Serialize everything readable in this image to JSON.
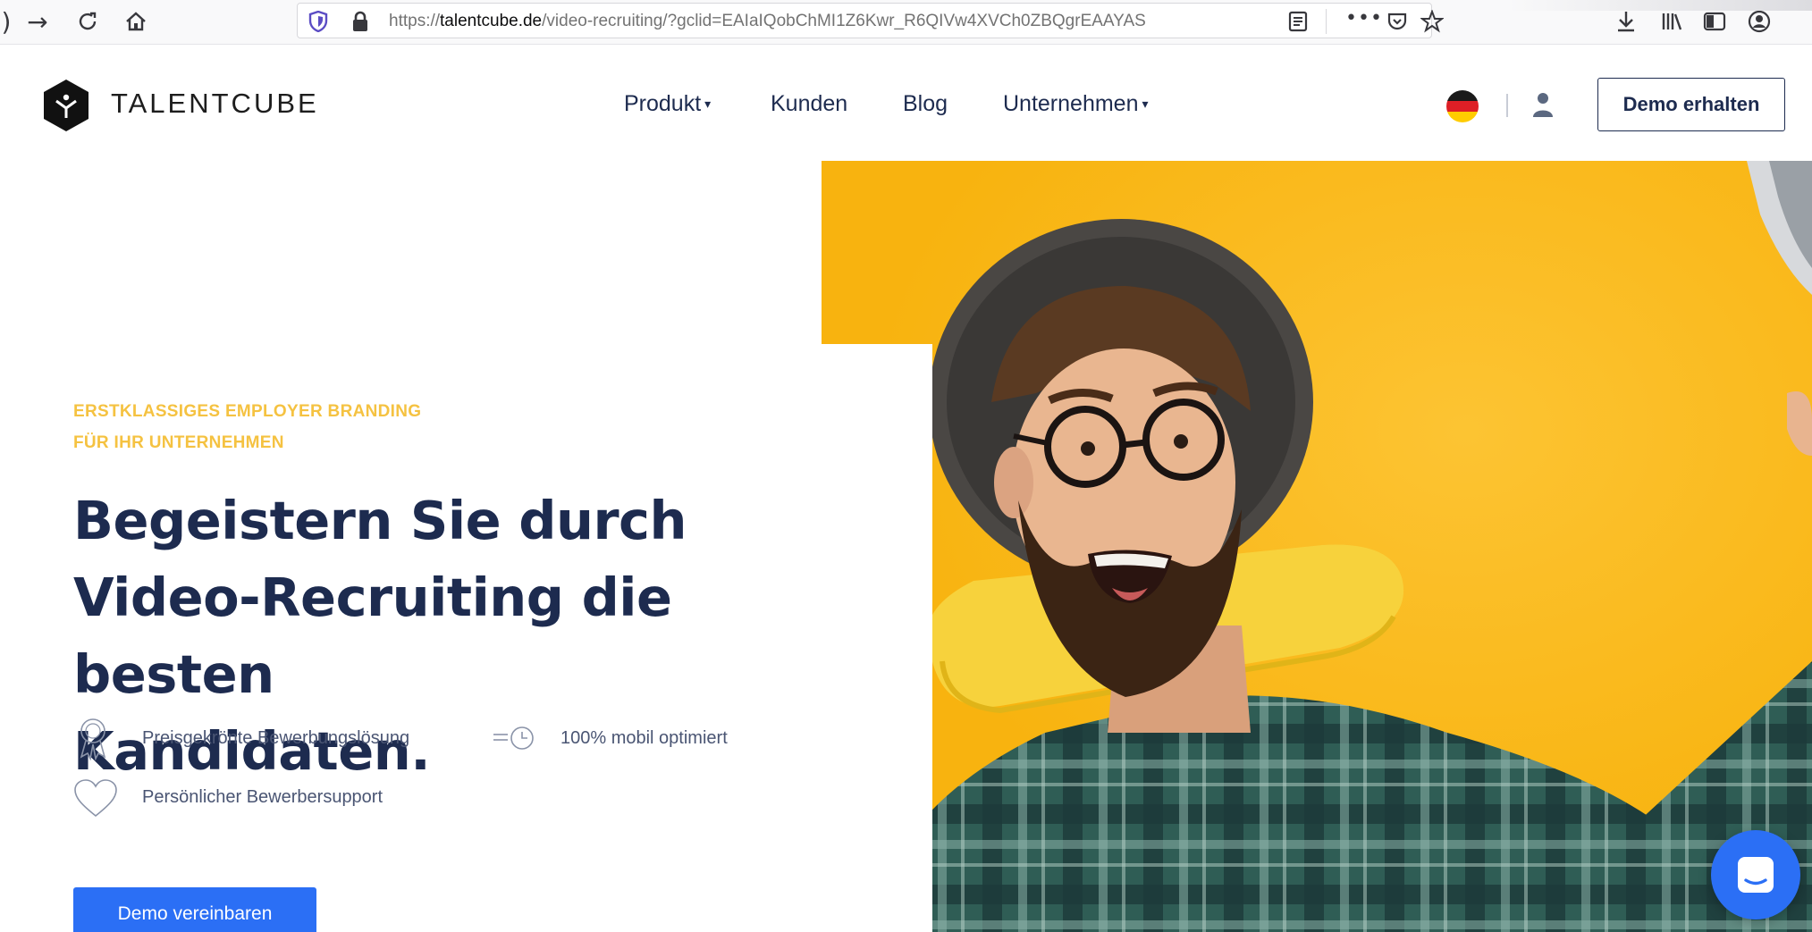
{
  "browser": {
    "url_prefix": "https://",
    "url_domain": "talentcube.de",
    "url_path": "/video-recruiting/?gclid=EAIaIQobChMI1Z6Kwr_R6QIVw4XVCh0ZBQgrEAAYAS",
    "icons": [
      "forward-icon",
      "reload-icon",
      "home-icon",
      "shield-icon",
      "lock-icon",
      "reader-view-icon",
      "more-icon",
      "pocket-icon",
      "bookmark-star-icon",
      "download-icon",
      "library-icon",
      "sidebar-icon",
      "account-icon"
    ],
    "more_label": "•••"
  },
  "header": {
    "logo_text": "TALENTCUBE",
    "nav": [
      {
        "label": "Produkt",
        "has_caret": true
      },
      {
        "label": "Kunden",
        "has_caret": false
      },
      {
        "label": "Blog",
        "has_caret": false
      },
      {
        "label": "Unternehmen",
        "has_caret": true
      }
    ],
    "caret": "▾",
    "demo_button": "Demo erhalten"
  },
  "hero": {
    "eyebrow_line1": "ERSTKLASSIGES EMPLOYER BRANDING",
    "eyebrow_line2": "FÜR IHR UNTERNEHMEN",
    "headline_line1": "Begeistern Sie durch",
    "headline_line2": "Video-Recruiting die besten",
    "headline_line3": "Kandidaten.",
    "features": [
      {
        "icon": "award-icon",
        "label": "Preisgekrönte Bewerbungslösung"
      },
      {
        "icon": "speed-clock-icon",
        "label": "100% mobil optimiert"
      },
      {
        "icon": "heart-icon",
        "label": "Persönlicher Bewerbersupport"
      }
    ],
    "cta_button": "Demo vereinbaren"
  },
  "colors": {
    "accent_yellow": "#f5c241",
    "hero_yellow": "#fbb917",
    "navy": "#1d2b4f",
    "cta_blue": "#2b6ff5"
  }
}
